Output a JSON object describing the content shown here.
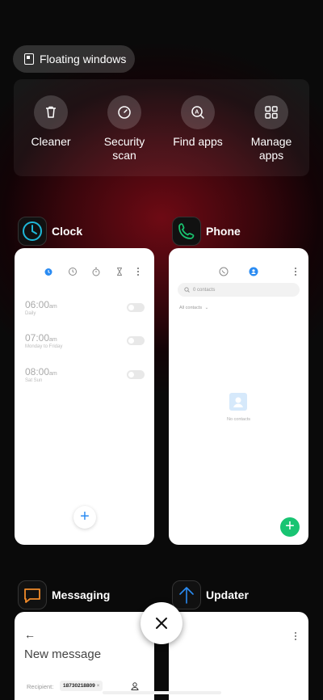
{
  "floating_windows": {
    "label": "Floating windows",
    "icon": "floating-window-icon"
  },
  "tools": [
    {
      "label_line1": "Cleaner",
      "label_line2": "",
      "icon": "trash-icon"
    },
    {
      "label_line1": "Security",
      "label_line2": "scan",
      "icon": "security-scan-icon"
    },
    {
      "label_line1": "Find apps",
      "label_line2": "",
      "icon": "find-apps-icon"
    },
    {
      "label_line1": "Manage",
      "label_line2": "apps",
      "icon": "grid-icon"
    }
  ],
  "apps": {
    "clock": {
      "name": "Clock",
      "accent": "#2a8bf2",
      "alarms": [
        {
          "time": "06:00",
          "ampm": "am",
          "repeat": "Daily"
        },
        {
          "time": "07:00",
          "ampm": "am",
          "repeat": "Monday to Friday"
        },
        {
          "time": "08:00",
          "ampm": "am",
          "repeat": "Sat Sun"
        }
      ]
    },
    "phone": {
      "name": "Phone",
      "search_placeholder": "0 contacts",
      "filter": "All contacts",
      "empty": "No contacts",
      "fab_color": "#18c472"
    },
    "messaging": {
      "name": "Messaging",
      "title": "New message",
      "recipient_label": "Recipient:",
      "recipient_value": "18730218809"
    },
    "updater": {
      "name": "Updater"
    }
  },
  "close_icon": "close-icon"
}
